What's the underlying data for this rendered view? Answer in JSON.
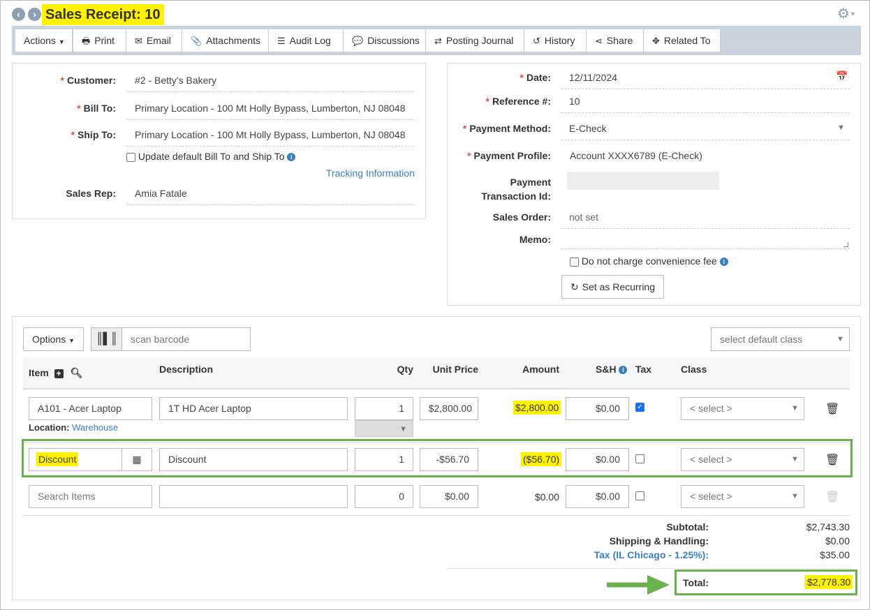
{
  "header": {
    "title": "Sales Receipt: 10"
  },
  "toolbar": {
    "actions": "Actions",
    "print": "Print",
    "email": "Email",
    "attachments": "Attachments",
    "audit_log": "Audit Log",
    "discussions": "Discussions",
    "posting_journal": "Posting Journal",
    "history": "History",
    "share": "Share",
    "related_to": "Related To"
  },
  "left": {
    "customer_label": "Customer:",
    "customer": "#2 - Betty's Bakery",
    "bill_to_label": "Bill To:",
    "bill_to": "Primary Location - 100 Mt Holly Bypass, Lumberton, NJ 08048",
    "ship_to_label": "Ship To:",
    "ship_to": "Primary Location - 100 Mt Holly Bypass, Lumberton, NJ 08048",
    "update_default": "Update default Bill To and Ship To",
    "tracking": "Tracking Information",
    "sales_rep_label": "Sales Rep:",
    "sales_rep": "Amia Fatale"
  },
  "right": {
    "date_label": "Date:",
    "date": "12/11/2024",
    "reference_label": "Reference #:",
    "reference": "10",
    "payment_method_label": "Payment Method:",
    "payment_method": "E-Check",
    "payment_profile_label": "Payment Profile:",
    "payment_profile": "Account XXXX6789 (E-Check)",
    "payment_txn_label_1": "Payment",
    "payment_txn_label_2": "Transaction Id:",
    "sales_order_label": "Sales Order:",
    "sales_order": "not set",
    "memo_label": "Memo:",
    "no_fee": "Do not charge convenience fee",
    "recurring": "Set as Recurring"
  },
  "items": {
    "options": "Options",
    "scan_placeholder": "scan barcode",
    "default_class": "select default class",
    "headers": {
      "item": "Item",
      "description": "Description",
      "qty": "Qty",
      "unit_price": "Unit Price",
      "amount": "Amount",
      "sh": "S&H",
      "tax": "Tax",
      "class": "Class"
    },
    "rows": [
      {
        "item": "A101 - Acer Laptop",
        "description": "1T HD Acer Laptop",
        "qty": "1",
        "unit_price": "$2,800.00",
        "amount": "$2,800.00",
        "sh": "$0.00",
        "tax": true,
        "class": "< select >",
        "location_label": "Location:",
        "location": "Warehouse"
      },
      {
        "item": "Discount",
        "description": "Discount",
        "qty": "1",
        "unit_price": "-$56.70",
        "amount": "($56.70)",
        "sh": "$0.00",
        "tax": false,
        "class": "< select >"
      },
      {
        "item_placeholder": "Search Items",
        "description": "",
        "qty": "0",
        "unit_price": "$0.00",
        "amount": "$0.00",
        "sh": "$0.00",
        "tax": false,
        "class": "< select >"
      }
    ]
  },
  "totals": {
    "subtotal_label": "Subtotal:",
    "subtotal": "$2,743.30",
    "sh_label": "Shipping & Handling:",
    "sh": "$0.00",
    "tax_label": "Tax (IL Chicago - 1.25%):",
    "tax": "$35.00",
    "total_label": "Total:",
    "total": "$2,778.30"
  },
  "colors": {
    "accent_green": "#6ab04c",
    "highlight": "#fff200",
    "link": "#3a7fc1",
    "required": "#d9534f"
  }
}
